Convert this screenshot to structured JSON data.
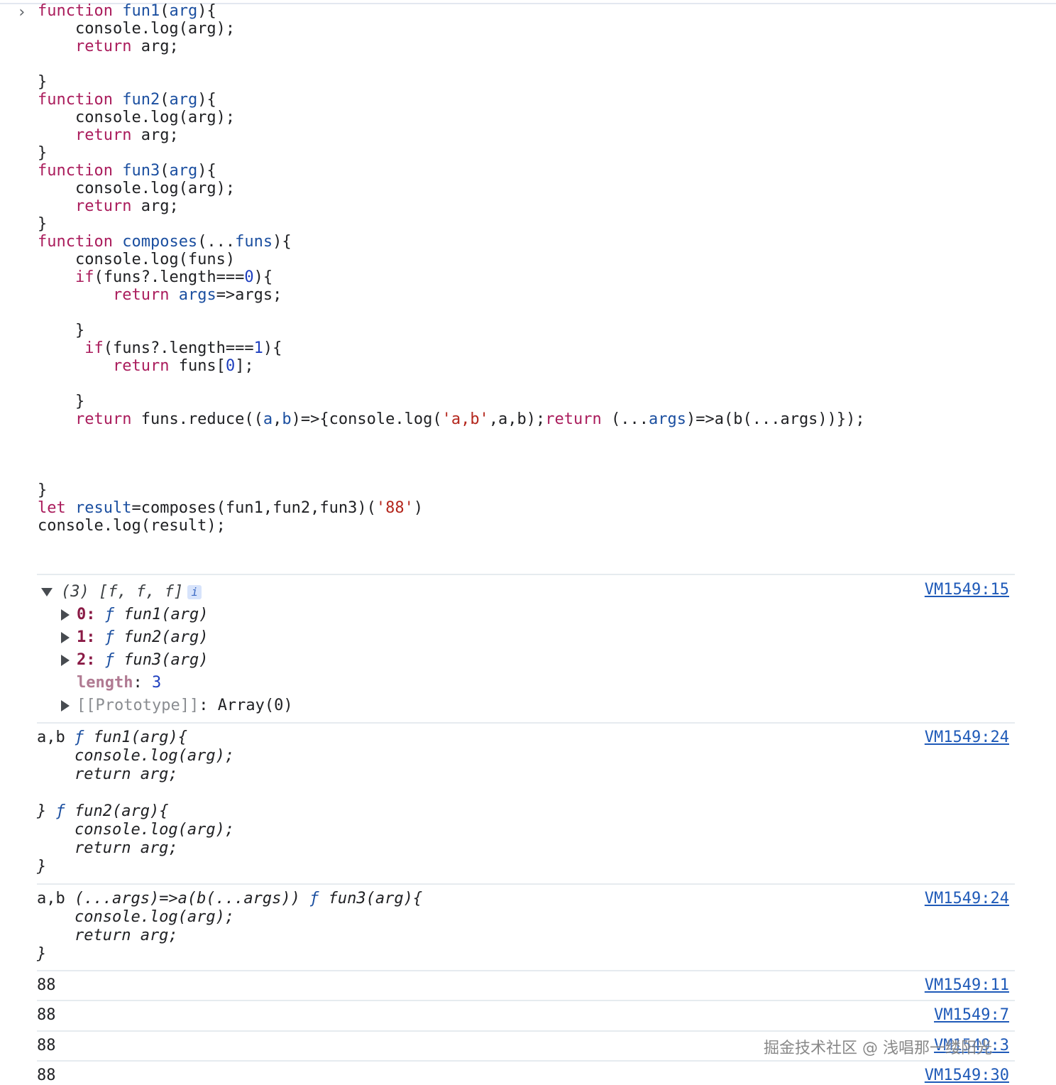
{
  "input": {
    "code_lines": [
      [
        [
          "kw",
          "function"
        ],
        [
          "t",
          " "
        ],
        [
          "fn",
          "fun1"
        ],
        [
          "t",
          "("
        ],
        [
          "prm",
          "arg"
        ],
        [
          "t",
          "){"
        ]
      ],
      [
        [
          "t",
          "    console.log(arg);"
        ]
      ],
      [
        [
          "t",
          "    "
        ],
        [
          "kw",
          "return"
        ],
        [
          "t",
          " arg;"
        ]
      ],
      [
        [
          "t",
          ""
        ]
      ],
      [
        [
          "t",
          "}"
        ]
      ],
      [
        [
          "kw",
          "function"
        ],
        [
          "t",
          " "
        ],
        [
          "fn",
          "fun2"
        ],
        [
          "t",
          "("
        ],
        [
          "prm",
          "arg"
        ],
        [
          "t",
          "){"
        ]
      ],
      [
        [
          "t",
          "    console.log(arg);"
        ]
      ],
      [
        [
          "t",
          "    "
        ],
        [
          "kw",
          "return"
        ],
        [
          "t",
          " arg;"
        ]
      ],
      [
        [
          "t",
          "}"
        ]
      ],
      [
        [
          "kw",
          "function"
        ],
        [
          "t",
          " "
        ],
        [
          "fn",
          "fun3"
        ],
        [
          "t",
          "("
        ],
        [
          "prm",
          "arg"
        ],
        [
          "t",
          "){"
        ]
      ],
      [
        [
          "t",
          "    console.log(arg);"
        ]
      ],
      [
        [
          "t",
          "    "
        ],
        [
          "kw",
          "return"
        ],
        [
          "t",
          " arg;"
        ]
      ],
      [
        [
          "t",
          "}"
        ]
      ],
      [
        [
          "kw",
          "function"
        ],
        [
          "t",
          " "
        ],
        [
          "fn",
          "composes"
        ],
        [
          "t",
          "(..."
        ],
        [
          "prm",
          "funs"
        ],
        [
          "t",
          "){"
        ]
      ],
      [
        [
          "t",
          "    console.log(funs)"
        ]
      ],
      [
        [
          "t",
          "    "
        ],
        [
          "kw",
          "if"
        ],
        [
          "t",
          "(funs?.length==="
        ],
        [
          "num",
          "0"
        ],
        [
          "t",
          "){"
        ]
      ],
      [
        [
          "t",
          "        "
        ],
        [
          "kw",
          "return"
        ],
        [
          "t",
          " "
        ],
        [
          "prm",
          "args"
        ],
        [
          "t",
          "=>args;"
        ]
      ],
      [
        [
          "t",
          ""
        ]
      ],
      [
        [
          "t",
          "    }"
        ]
      ],
      [
        [
          "t",
          "     "
        ],
        [
          "kw",
          "if"
        ],
        [
          "t",
          "(funs?.length==="
        ],
        [
          "num",
          "1"
        ],
        [
          "t",
          "){"
        ]
      ],
      [
        [
          "t",
          "        "
        ],
        [
          "kw",
          "return"
        ],
        [
          "t",
          " funs["
        ],
        [
          "num",
          "0"
        ],
        [
          "t",
          "];"
        ]
      ],
      [
        [
          "t",
          ""
        ]
      ],
      [
        [
          "t",
          "    }"
        ]
      ],
      [
        [
          "t",
          "    "
        ],
        [
          "kw",
          "return"
        ],
        [
          "t",
          " funs.reduce(("
        ],
        [
          "prm",
          "a"
        ],
        [
          "t",
          ","
        ],
        [
          "prm",
          "b"
        ],
        [
          "t",
          ")=>{console.log("
        ],
        [
          "str",
          "'a,b'"
        ],
        [
          "t",
          ",a,b);"
        ],
        [
          "kw",
          "return"
        ],
        [
          "t",
          " (..."
        ],
        [
          "prm",
          "args"
        ],
        [
          "t",
          ")=>a(b(...args))});"
        ]
      ],
      [
        [
          "t",
          ""
        ]
      ],
      [
        [
          "t",
          ""
        ]
      ],
      [
        [
          "t",
          ""
        ]
      ],
      [
        [
          "t",
          "}"
        ]
      ],
      [
        [
          "kw",
          "let"
        ],
        [
          "t",
          " "
        ],
        [
          "fn",
          "result"
        ],
        [
          "t",
          "=composes(fun1,fun2,fun3)("
        ],
        [
          "str",
          "'88'"
        ],
        [
          "t",
          ")"
        ]
      ],
      [
        [
          "t",
          "console.log(result);"
        ]
      ]
    ]
  },
  "output": {
    "array_log": {
      "header": "(3) [f, f, f]",
      "info_badge": "i",
      "source": "VM1549:15",
      "items": [
        {
          "key": "0",
          "f": "ƒ",
          "sig": "fun1(arg)"
        },
        {
          "key": "1",
          "f": "ƒ",
          "sig": "fun2(arg)"
        },
        {
          "key": "2",
          "f": "ƒ",
          "sig": "fun3(arg)"
        }
      ],
      "length_key": "length",
      "length_value": "3",
      "prototype_key": "[[Prototype]]",
      "prototype_value": "Array(0)"
    },
    "reduce_log_1": {
      "prefix": "a,b",
      "f1": "ƒ",
      "fn1_lines": [
        "fun1(arg){",
        "    console.log(arg);",
        "    return arg;",
        "",
        "}"
      ],
      "f2": "ƒ",
      "fn2_lines": [
        "fun2(arg){",
        "    console.log(arg);",
        "    return arg;",
        "}"
      ],
      "source": "VM1549:24"
    },
    "reduce_log_2": {
      "prefix": "a,b",
      "arrow": "(...args)=>a(b(...args))",
      "f": "ƒ",
      "fn_lines": [
        "fun3(arg){",
        "    console.log(arg);",
        "    return arg;",
        "}"
      ],
      "source": "VM1549:24"
    },
    "value_logs": [
      {
        "value": "88",
        "source": "VM1549:11"
      },
      {
        "value": "88",
        "source": "VM1549:7"
      },
      {
        "value": "88",
        "source": "VM1549:3"
      },
      {
        "value": "88",
        "source": "VM1549:30"
      }
    ]
  },
  "watermark": "掘金技术社区 @ 浅唱那一缕阳光",
  "colors": {
    "keyword": "#aa1c5c",
    "function_name": "#1b4fa0",
    "number": "#1e3fbf",
    "string": "#b4271d",
    "link": "#1f5ab8",
    "separator": "#e6ebef"
  }
}
